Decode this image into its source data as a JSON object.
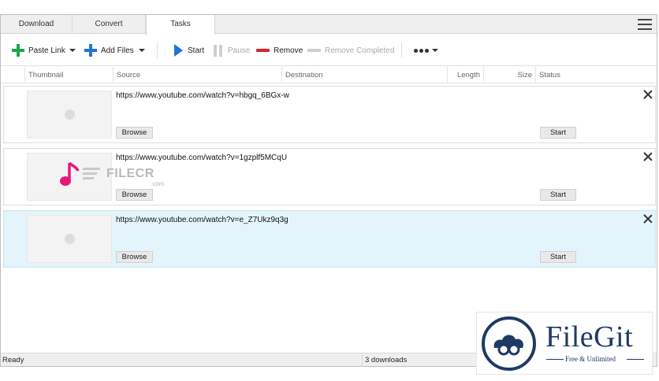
{
  "tabs": [
    {
      "label": "Download",
      "active": false
    },
    {
      "label": "Convert",
      "active": false
    },
    {
      "label": "Tasks",
      "active": true
    }
  ],
  "toolbar": {
    "paste_link": "Paste Link",
    "add_files": "Add Files",
    "start": "Start",
    "pause": "Pause",
    "remove": "Remove",
    "remove_completed": "Remove Completed"
  },
  "columns": {
    "thumbnail": "Thumbnail",
    "source": "Source",
    "destination": "Destination",
    "length": "Length",
    "size": "Size",
    "status": "Status"
  },
  "tasks": [
    {
      "url": "https://www.youtube.com/watch?v=hbgq_6BGx-w",
      "browse": "Browse",
      "start": "Start",
      "selected": false
    },
    {
      "url": "https://www.youtube.com/watch?v=1gzplf5MCqU",
      "browse": "Browse",
      "start": "Start",
      "selected": false
    },
    {
      "url": "https://www.youtube.com/watch?v=e_Z7Ukz9q3g",
      "browse": "Browse",
      "start": "Start",
      "selected": true
    }
  ],
  "status": {
    "left": "Ready",
    "downloads": "3 downloads"
  },
  "watermarks": {
    "filecr": "FILECR",
    "filecr_domain": ".com",
    "filegit_title": "FileGit",
    "filegit_subtitle": "Free & Unlimited"
  },
  "colors": {
    "accent_blue": "#1f74d6",
    "paste_green": "#1aa64a",
    "remove_red": "#e0202a",
    "selected_row": "#e3f5fb",
    "filegit_navy": "#1f3a63",
    "filecr_pink": "#e8177a"
  }
}
